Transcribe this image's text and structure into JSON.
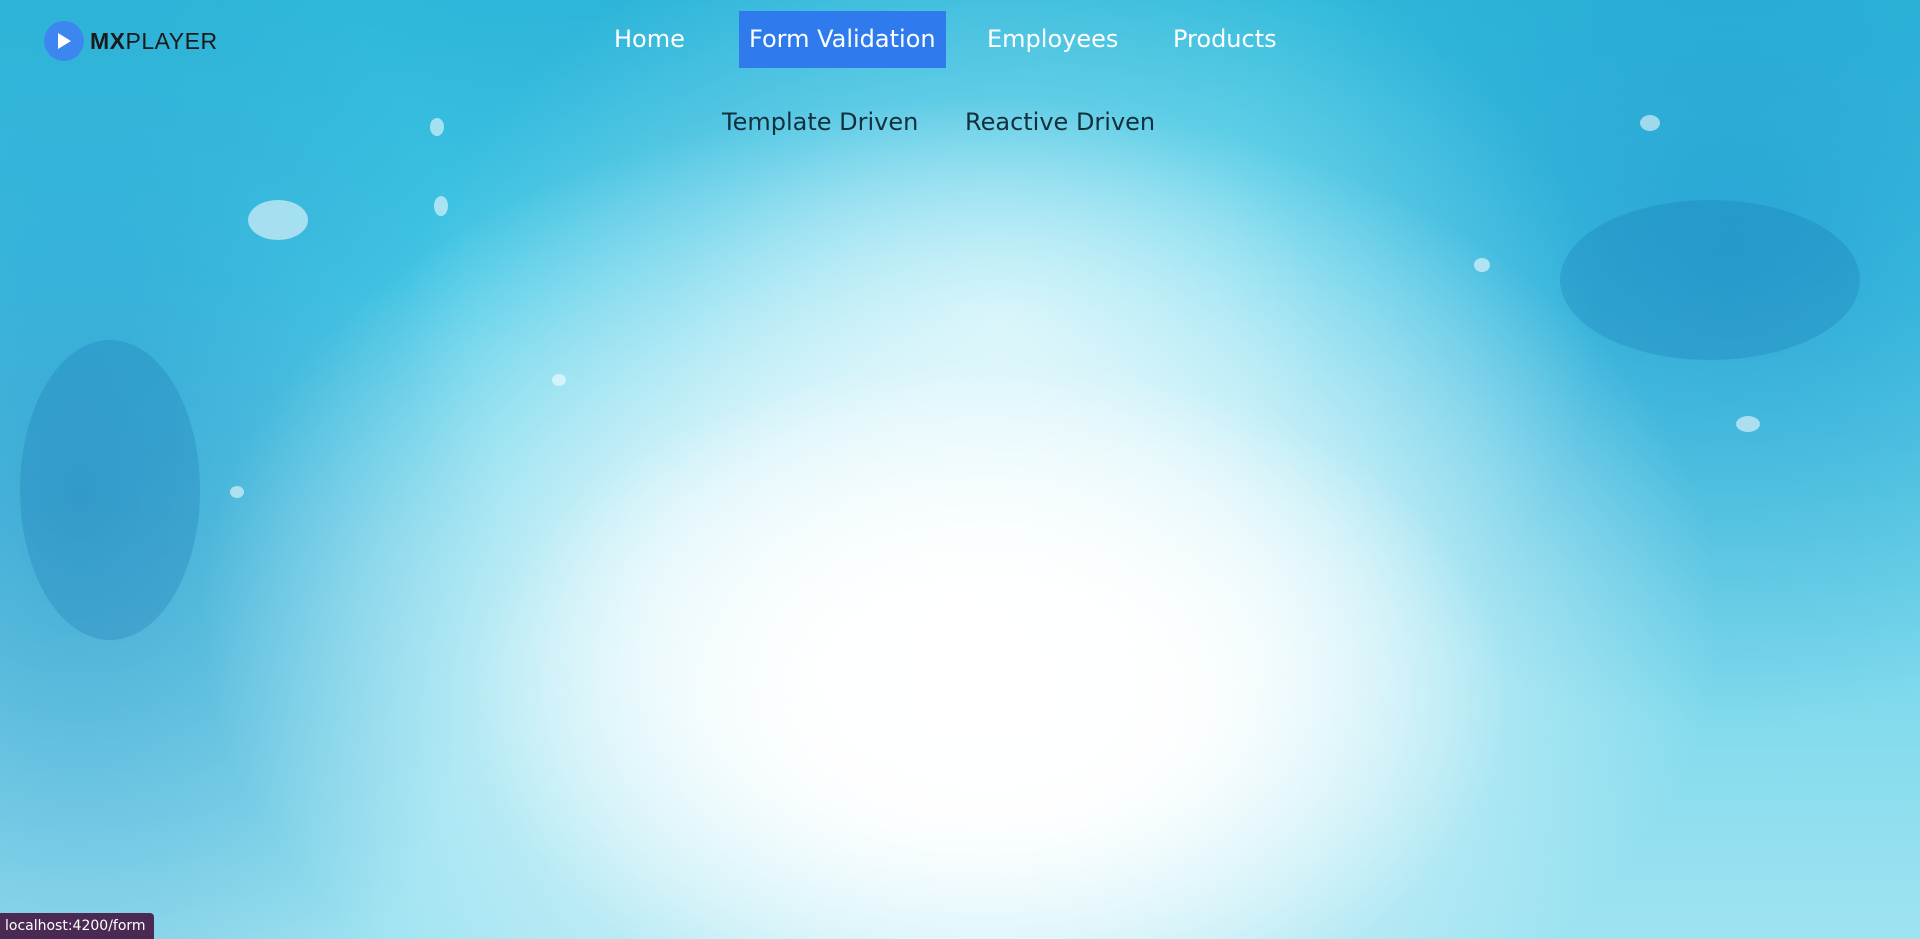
{
  "brand": {
    "name_bold": "MX",
    "name_rest": "PLAYER",
    "icon": "play-icon",
    "accent_color": "#3d86ef"
  },
  "nav": {
    "items": [
      {
        "label": "Home",
        "active": false
      },
      {
        "label": "Form Validation",
        "active": true
      },
      {
        "label": "Employees",
        "active": false
      },
      {
        "label": "Products",
        "active": false
      }
    ],
    "active_color": "#2f7bed"
  },
  "subnav": {
    "items": [
      {
        "label": "Template Driven"
      },
      {
        "label": "Reactive Driven"
      }
    ]
  },
  "status_bar": {
    "url": "localhost:4200/form"
  }
}
